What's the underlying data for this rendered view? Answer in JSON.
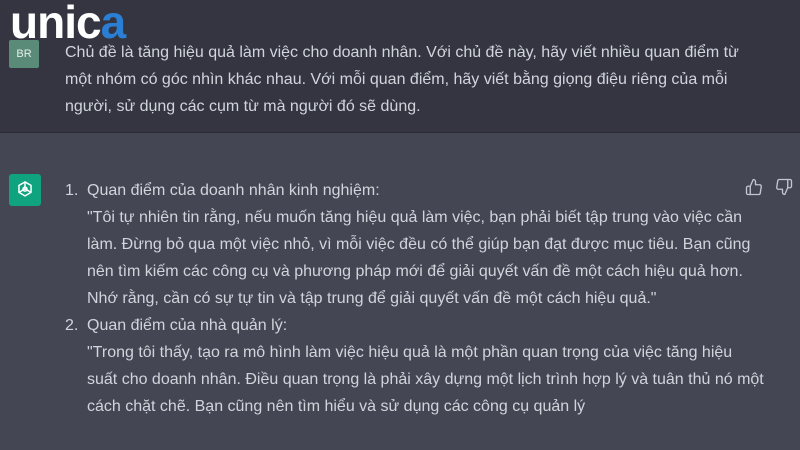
{
  "logo": {
    "unic": "unic",
    "a": "a"
  },
  "user": {
    "avatar_initials": "BR",
    "message": "Chủ đề là tăng hiệu quả làm việc cho doanh nhân. Với chủ đề này, hãy viết nhiều quan điểm từ một nhóm có góc nhìn khác nhau. Với mỗi quan điểm, hãy viết bằng giọng điệu riêng của mỗi người, sử dụng các cụm từ mà người đó sẽ dùng."
  },
  "assistant": {
    "icon": "openai-logo-icon",
    "items": [
      {
        "number": "1.",
        "title": "Quan điểm của doanh nhân kinh nghiệm:",
        "quote": "\"Tôi tự nhiên tin rằng, nếu muốn tăng hiệu quả làm việc, bạn phải biết tập trung vào việc cần làm. Đừng bỏ qua một việc nhỏ, vì mỗi việc đều có thể giúp bạn đạt được mục tiêu. Bạn cũng nên tìm kiếm các công cụ và phương pháp mới để giải quyết vấn đề một cách hiệu quả hơn. Nhớ rằng, cần có sự tự tin và tập trung để giải quyết vấn đề một cách hiệu quả.\""
      },
      {
        "number": "2.",
        "title": "Quan điểm của nhà quản lý:",
        "quote": "\"Trong tôi thấy, tạo ra mô hình làm việc hiệu quả là một phần quan trọng của việc tăng hiệu suất cho doanh nhân. Điều quan trọng là phải xây dựng một lịch trình hợp lý và tuân thủ nó một cách chặt chẽ. Bạn cũng nên tìm hiểu và sử dụng các công cụ quản lý"
      }
    ]
  },
  "icons": {
    "like": "thumbs-up-icon",
    "dislike": "thumbs-down-icon"
  },
  "colors": {
    "background": "#343541",
    "assistant_bg": "#444654",
    "accent": "#10a37f",
    "logo_accent": "#2a7fd4"
  }
}
